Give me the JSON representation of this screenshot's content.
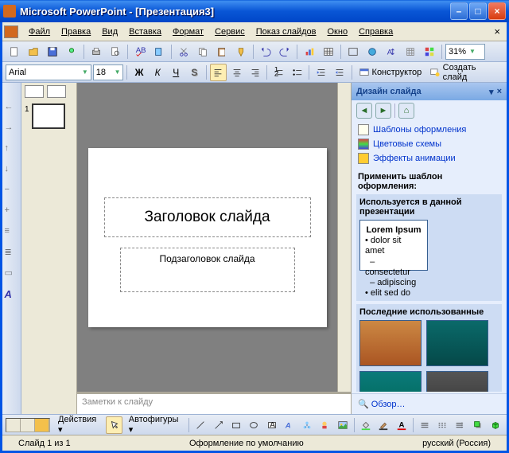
{
  "title": "Microsoft PowerPoint  - [Презентация3]",
  "menu": [
    "Файл",
    "Правка",
    "Вид",
    "Вставка",
    "Формат",
    "Сервис",
    "Показ слайдов",
    "Окно",
    "Справка"
  ],
  "toolbar1": {
    "zoom": "31%"
  },
  "toolbar2": {
    "font": "Arial",
    "size": "18",
    "designer": "Конструктор",
    "newslide": "Создать слайд"
  },
  "thumbs": {
    "num1": "1"
  },
  "slide": {
    "title_ph": "Заголовок слайда",
    "subtitle_ph": "Подзаголовок слайда"
  },
  "notes": {
    "placeholder": "Заметки к слайду"
  },
  "taskpane": {
    "title": "Дизайн слайда",
    "links": {
      "templates": "Шаблоны оформления",
      "colors": "Цветовые схемы",
      "anim": "Эффекты анимации"
    },
    "apply_label": "Применить шаблон оформления:",
    "group_current": "Используется в данной презентации",
    "group_recent": "Последние использованные",
    "browse": "Обзор…"
  },
  "drawbar": {
    "actions": "Действия",
    "autoshapes": "Автофигуры"
  },
  "status": {
    "slide": "Слайд 1 из 1",
    "design": "Оформление по умолчанию",
    "lang": "русский (Россия)"
  }
}
